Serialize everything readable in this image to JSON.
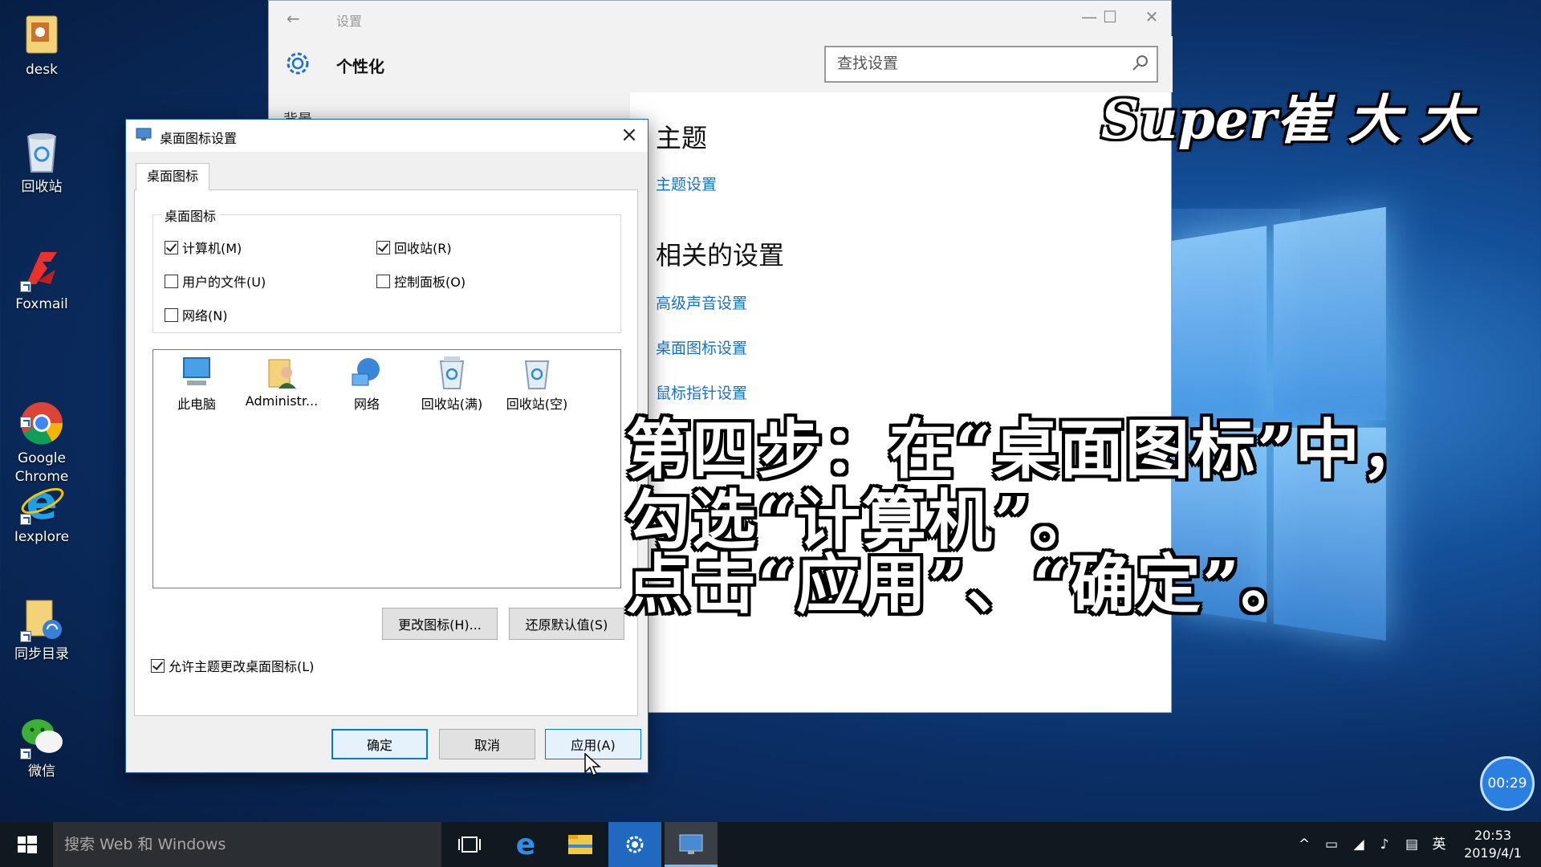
{
  "desktop": {
    "icons": [
      {
        "label": "desk",
        "icon": "folder-icon"
      },
      {
        "label": "回收站",
        "icon": "recycle-bin-icon"
      },
      {
        "label": "Foxmail",
        "icon": "foxmail-icon"
      },
      {
        "label": "Google\nChrome",
        "icon": "chrome-icon"
      },
      {
        "label": "Iexplore",
        "icon": "ie-icon"
      },
      {
        "label": "同步目录",
        "icon": "sync-folder-icon"
      },
      {
        "label": "微信",
        "icon": "wechat-icon"
      }
    ]
  },
  "settings": {
    "window_title": "设置",
    "page_title": "个性化",
    "search_placeholder": "查找设置",
    "left_subheading": "背景",
    "theme_heading": "主题",
    "theme_link": "主题设置",
    "related_heading": "相关的设置",
    "related_links": [
      "高级声音设置",
      "桌面图标设置",
      "鼠标指针设置"
    ]
  },
  "dialog": {
    "title": "桌面图标设置",
    "tab": "桌面图标",
    "group_label": "桌面图标",
    "checkboxes": [
      {
        "label": "计算机(M)",
        "checked": true
      },
      {
        "label": "回收站(R)",
        "checked": true
      },
      {
        "label": "用户的文件(U)",
        "checked": false
      },
      {
        "label": "控制面板(O)",
        "checked": false
      },
      {
        "label": "网络(N)",
        "checked": false
      }
    ],
    "icons": [
      {
        "label": "此电脑",
        "icon": "computer-icon"
      },
      {
        "label": "Administr...",
        "icon": "user-folder-icon"
      },
      {
        "label": "网络",
        "icon": "network-icon"
      },
      {
        "label": "回收站(满)",
        "icon": "recycle-bin-full-icon"
      },
      {
        "label": "回收站(空)",
        "icon": "recycle-bin-empty-icon"
      }
    ],
    "change_icon_btn": "更改图标(H)...",
    "restore_default_btn": "还原默认值(S)",
    "allow_theme_label": "允许主题更改桌面图标(L)",
    "allow_theme_checked": true,
    "ok_btn": "确定",
    "cancel_btn": "取消",
    "apply_btn": "应用(A)"
  },
  "overlay": {
    "watermark": "Super崔 大 大",
    "caption_lines": [
      "第四步：在“桌面图标”中，",
      "勾选“计算机”。",
      "点击“应用”、“确定”。"
    ],
    "timer": "00:29"
  },
  "taskbar": {
    "search_placeholder": "搜索 Web 和 Windows",
    "ime": "英",
    "time": "20:53",
    "date": "2019/4/1"
  },
  "colors": {
    "accent": "#0078d7",
    "link": "#1a72c9",
    "taskbar": "#101820"
  }
}
